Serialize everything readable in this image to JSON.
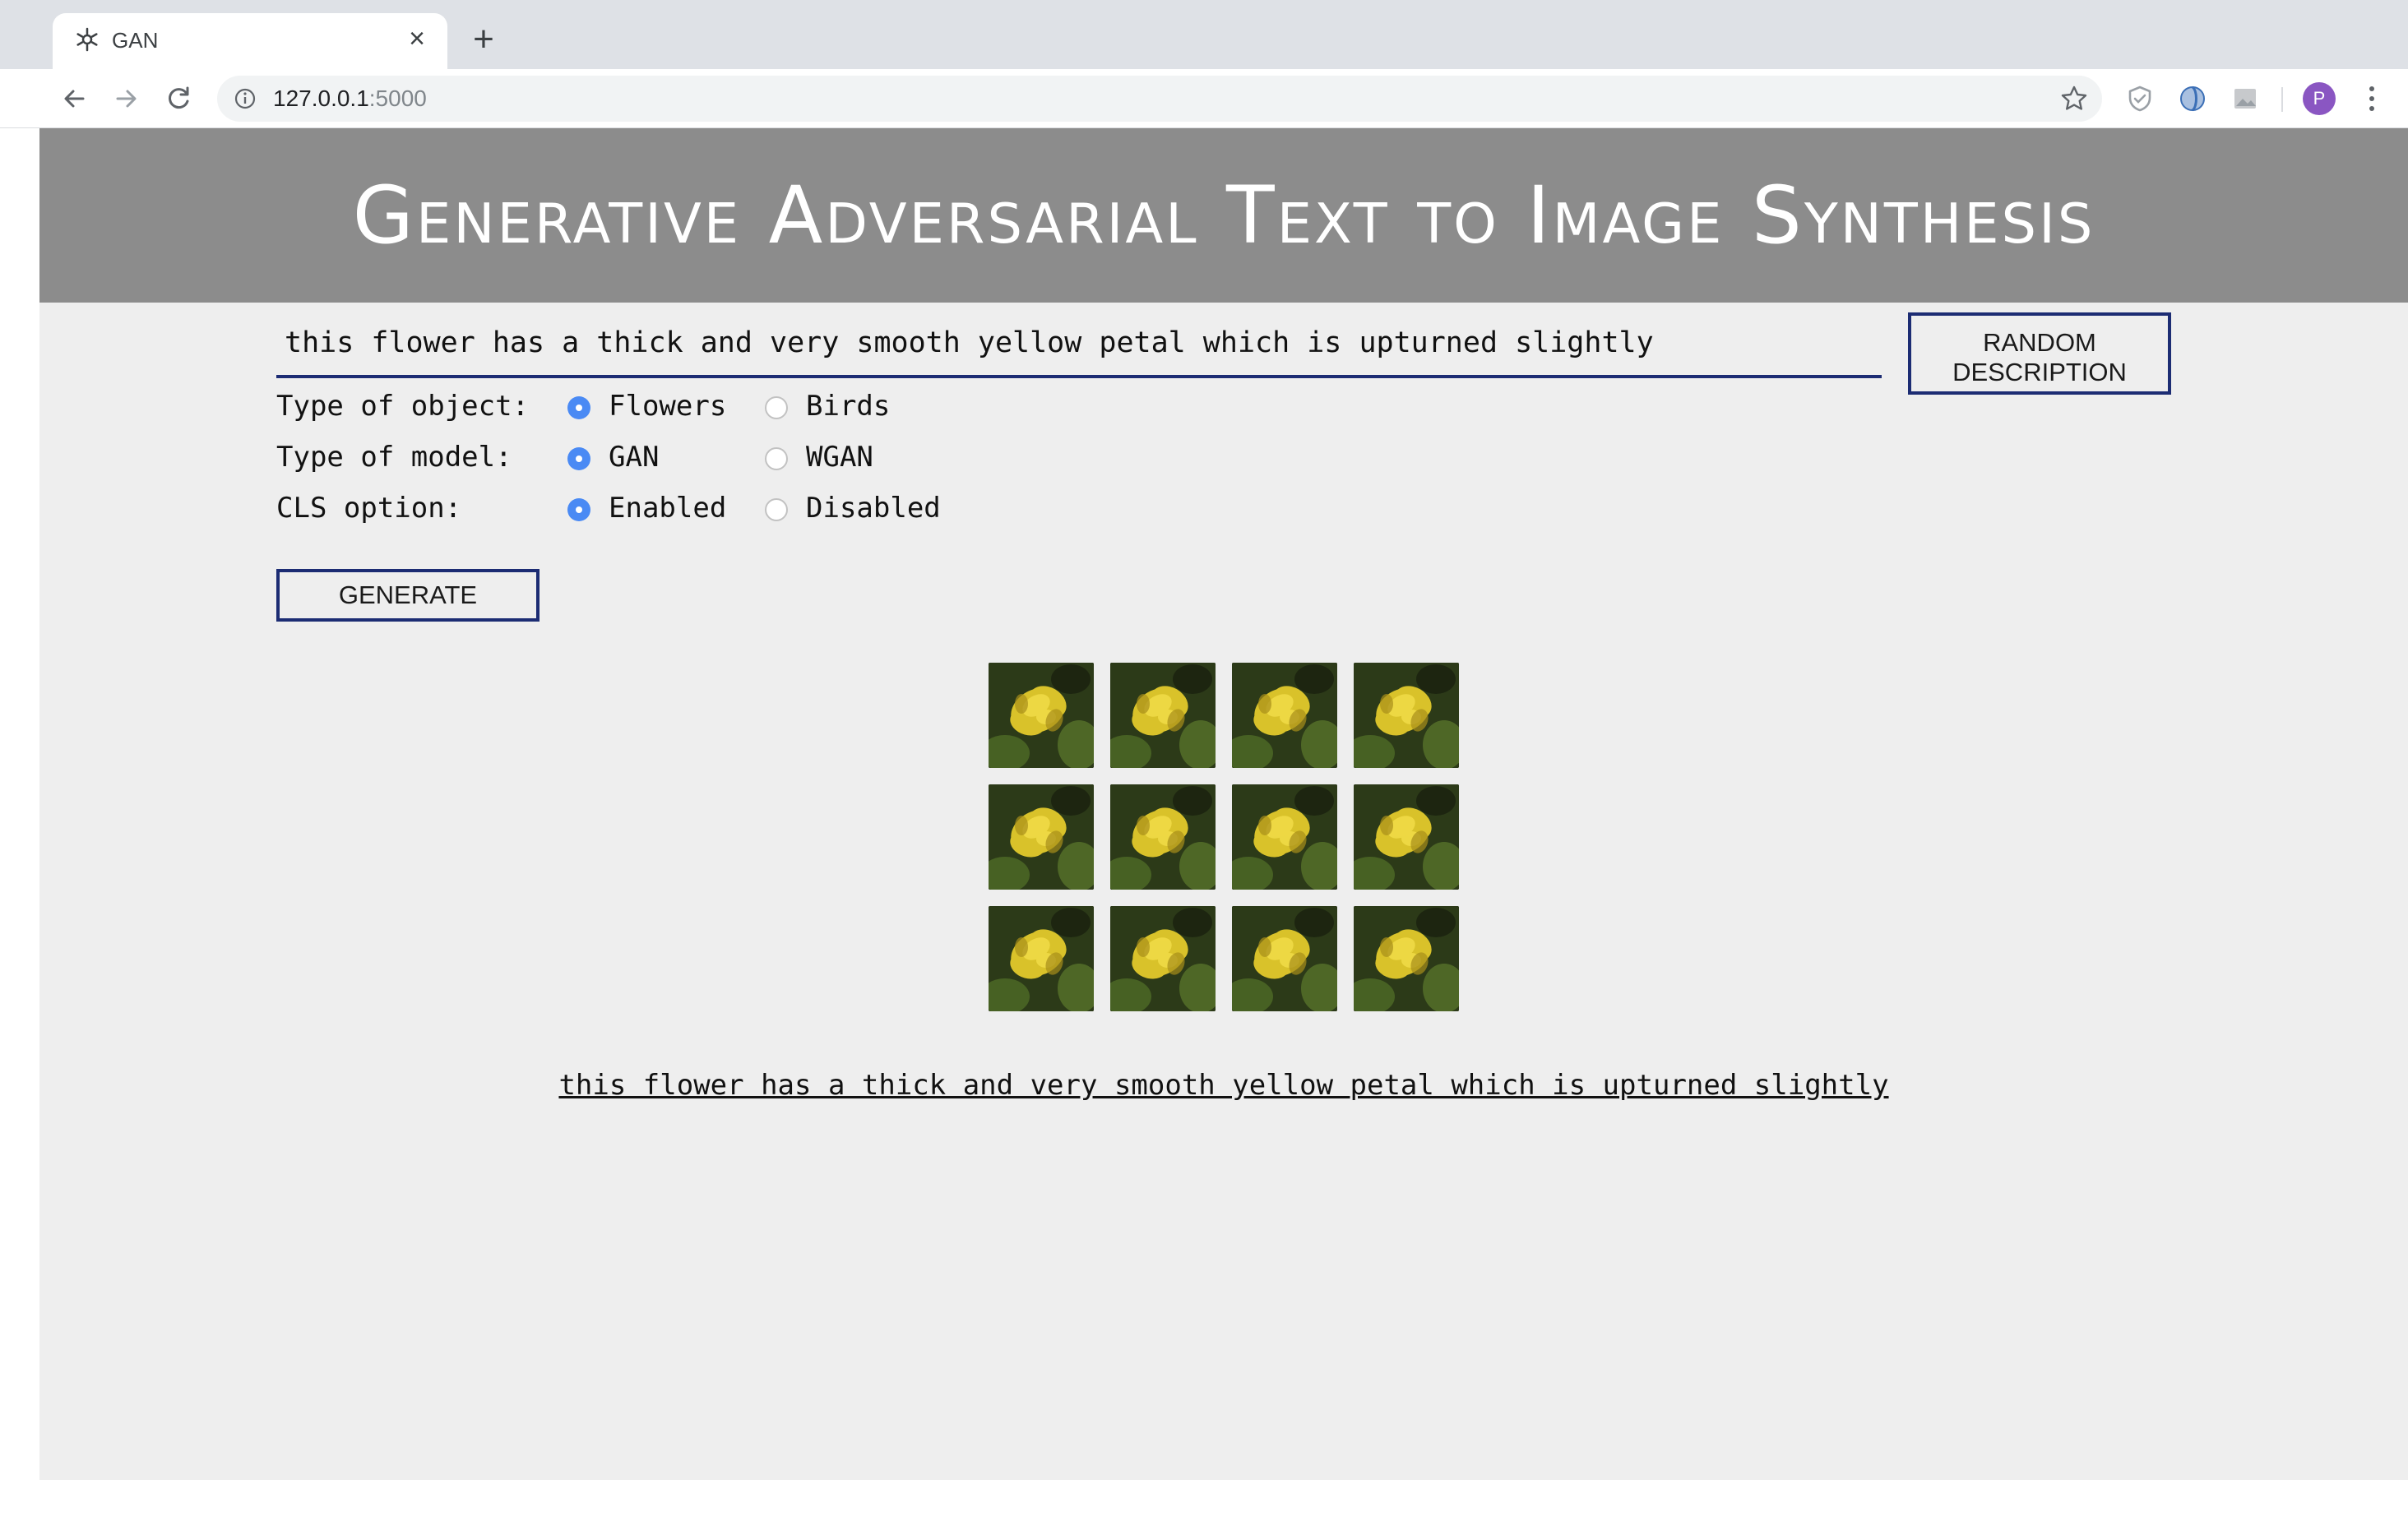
{
  "browser": {
    "tab_title": "GAN",
    "url_host": "127.0.0.1",
    "url_port": ":5000",
    "profile_initial": "P"
  },
  "page": {
    "title": "Generative Adversarial Text to Image Synthesis",
    "description_value": "this flower has a thick and very smooth yellow petal which is upturned slightly",
    "random_button": "RANDOM DESCRIPTION",
    "generate_button": "GENERATE",
    "options": {
      "object": {
        "label": "Type of object:",
        "choices": [
          "Flowers",
          "Birds"
        ],
        "selected": "Flowers"
      },
      "model": {
        "label": "Type of model:",
        "choices": [
          "GAN",
          "WGAN"
        ],
        "selected": "GAN"
      },
      "cls": {
        "label": "CLS option:",
        "choices": [
          "Enabled",
          "Disabled"
        ],
        "selected": "Enabled"
      }
    },
    "generated_images": {
      "rows": 3,
      "columns": 4,
      "subject": "yellow-flower"
    },
    "caption": "this flower has a thick and very smooth yellow petal which is upturned slightly"
  },
  "colors": {
    "banner": "#8c8c8c",
    "page_background": "#eeeeee",
    "accent_border": "#1c2c73",
    "radio_selected": "#4a8af4",
    "avatar": "#8a56c2"
  }
}
